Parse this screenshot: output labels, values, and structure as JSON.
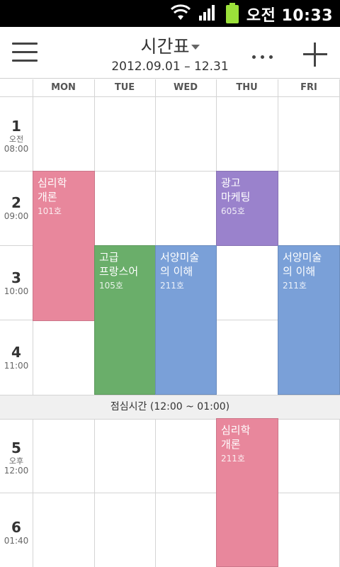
{
  "status_bar": {
    "time": "오전 10:33",
    "icons": [
      "wifi-icon",
      "signal-icon",
      "battery-icon"
    ]
  },
  "app_bar": {
    "title": "시간표",
    "date_range": "2012.09.01 – 12.31",
    "icons": [
      "menu-icon",
      "chevron-down-icon",
      "more-icon",
      "add-icon"
    ]
  },
  "days": [
    "MON",
    "TUE",
    "WED",
    "THU",
    "FRI"
  ],
  "periods": [
    {
      "num": "1",
      "ampm": "오전",
      "time": "08:00"
    },
    {
      "num": "2",
      "ampm": "",
      "time": "09:00"
    },
    {
      "num": "3",
      "ampm": "",
      "time": "10:00"
    },
    {
      "num": "4",
      "ampm": "",
      "time": "11:00"
    },
    {
      "num": "5",
      "ampm": "오후",
      "time": "12:00"
    },
    {
      "num": "6",
      "ampm": "",
      "time": "01:40"
    }
  ],
  "lunch_label": "점심시간 (12:00 ~ 01:00)",
  "events": [
    {
      "name": "심리학\n개론",
      "room": "101호",
      "color": "#e8879c"
    },
    {
      "name": "광고\n마케팅",
      "room": "605호",
      "color": "#9a82cc"
    },
    {
      "name": "고급\n프랑스어",
      "room": "105호",
      "color": "#6aae6a"
    },
    {
      "name": "서양미술\n의 이해",
      "room": "211호",
      "color": "#7aa0d8"
    },
    {
      "name": "서양미술\n의 이해",
      "room": "211호",
      "color": "#7aa0d8"
    },
    {
      "name": "심리학\n개론",
      "room": "211호",
      "color": "#e8879c"
    }
  ]
}
